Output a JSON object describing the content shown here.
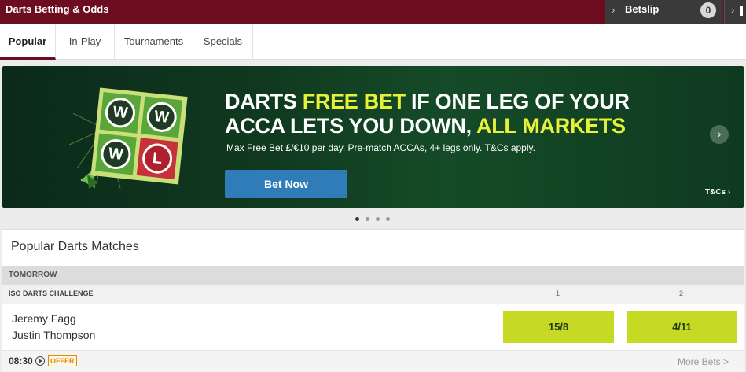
{
  "header": {
    "title": "Darts Betting & Odds",
    "betslip_label": "Betslip",
    "betslip_count": "0"
  },
  "tabs": [
    {
      "label": "Popular",
      "active": true
    },
    {
      "label": "In-Play"
    },
    {
      "label": "Tournaments"
    },
    {
      "label": "Specials"
    }
  ],
  "banner": {
    "board_letters": [
      "W",
      "W",
      "W",
      "L"
    ],
    "headline_part1": "DARTS ",
    "headline_hl1": "FREE BET",
    "headline_part2": " IF ONE LEG OF YOUR",
    "headline_part3": "ACCA LETS YOU DOWN, ",
    "headline_hl2": "ALL MARKETS",
    "subline": "Max Free Bet £/€10 per day. Pre-match ACCAs, 4+ legs only. T&Cs apply.",
    "cta": "Bet Now",
    "tcs": "T&Cs",
    "slides": 4,
    "active_slide": 1
  },
  "matches": {
    "title": "Popular Darts Matches",
    "day": "TOMORROW",
    "competition": "ISO DARTS CHALLENGE",
    "col1": "1",
    "col2": "2",
    "event": {
      "player1": "Jeremy Fagg",
      "player2": "Justin Thompson",
      "odds1": "15/8",
      "odds2": "4/11",
      "time": "08:30",
      "offer": "OFFER",
      "more": "More Bets >"
    }
  },
  "colors": {
    "header": "#6d0c1f",
    "odds": "#c6d923",
    "cta": "#2f7cb8",
    "highlight": "#e6f13a"
  },
  "icons": [
    "chevron-right-icon",
    "play-icon",
    "dart-icon"
  ]
}
